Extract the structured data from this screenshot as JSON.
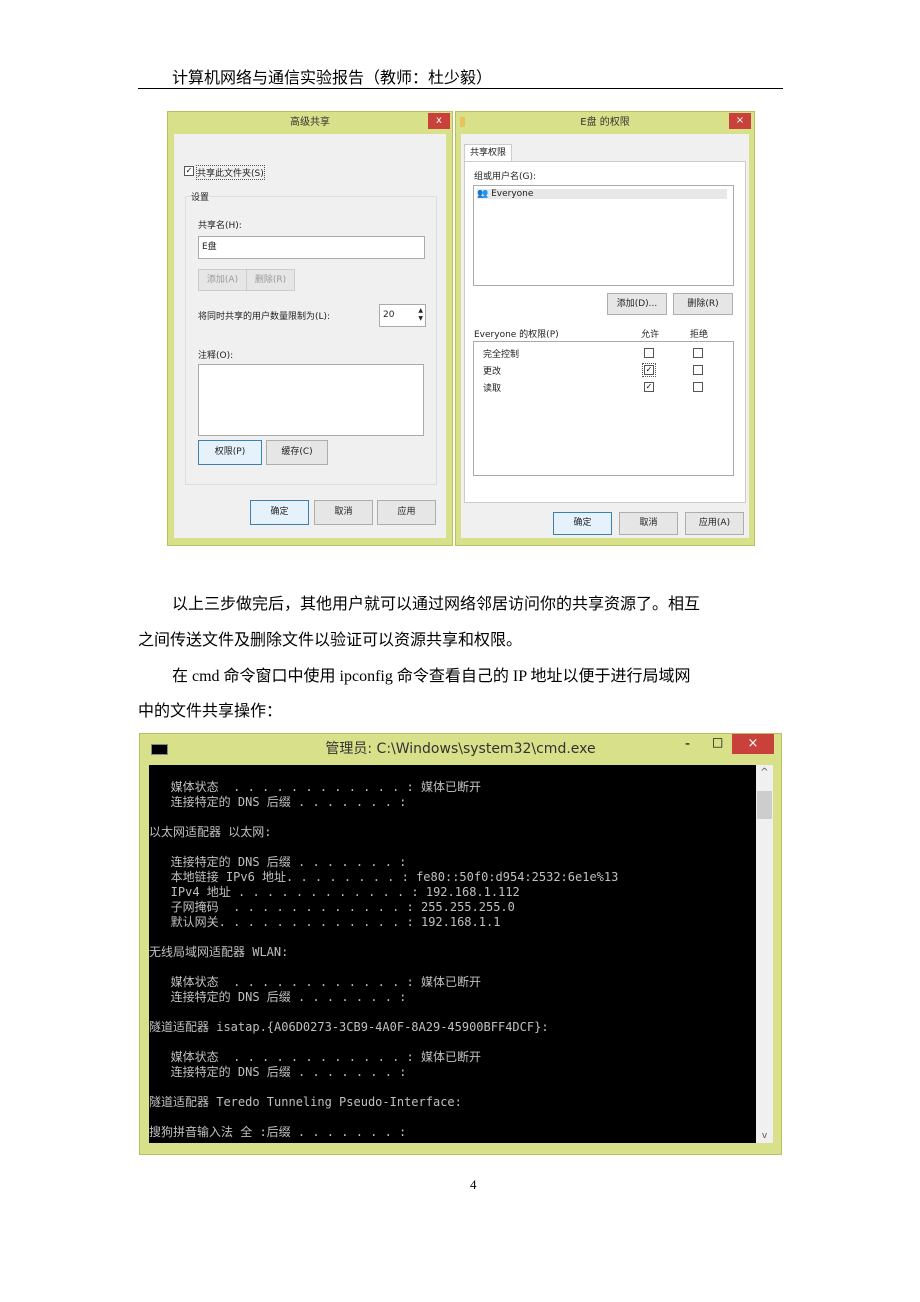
{
  "header": "计算机网络与通信实验报告（教师：杜少毅）",
  "adv_share": {
    "title": "高级共享",
    "close": "x",
    "share_checkbox": "共享此文件夹(S)",
    "settings_group": "设置",
    "share_name_label": "共享名(H):",
    "share_name_value": "E盘",
    "add": "添加(A)",
    "remove": "删除(R)",
    "limit_label": "将同时共享的用户数量限制为(L):",
    "limit_value": "20",
    "comment_label": "注释(O):",
    "permissions": "权限(P)",
    "caching": "缓存(C)",
    "ok": "确定",
    "cancel": "取消",
    "apply": "应用"
  },
  "perm": {
    "title": "E盘 的权限",
    "close": "×",
    "tab": "共享权限",
    "group_label": "组或用户名(G):",
    "users": [
      "Everyone"
    ],
    "add": "添加(D)...",
    "remove": "删除(R)",
    "perm_label": "Everyone 的权限(P)",
    "allow": "允许",
    "deny": "拒绝",
    "rows": [
      {
        "name": "完全控制",
        "allow": false,
        "deny": false
      },
      {
        "name": "更改",
        "allow": true,
        "deny": false
      },
      {
        "name": "读取",
        "allow": true,
        "deny": false
      }
    ],
    "ok": "确定",
    "cancel": "取消",
    "apply": "应用(A)"
  },
  "paragraphs": [
    "以上三步做完后，其他用户就可以通过网络邻居访问你的共享资源了。相互",
    "之间传送文件及删除文件以验证可以资源共享和权限。",
    "在 cmd 命令窗口中使用 ipconfig 命令查看自己的 IP 地址以便于进行局域网",
    "中的文件共享操作："
  ],
  "cmd": {
    "title": "管理员: C:\\Windows\\system32\\cmd.exe",
    "lines": [
      "   媒体状态  . . . . . . . . . . . . : 媒体已断开",
      "   连接特定的 DNS 后缀 . . . . . . . :",
      "",
      "以太网适配器 以太网:",
      "",
      "   连接特定的 DNS 后缀 . . . . . . . :",
      "   本地链接 IPv6 地址. . . . . . . . : fe80::50f0:d954:2532:6e1e%13",
      "   IPv4 地址 . . . . . . . . . . . . : 192.168.1.112",
      "   子网掩码  . . . . . . . . . . . . : 255.255.255.0",
      "   默认网关. . . . . . . . . . . . . : 192.168.1.1",
      "",
      "无线局域网适配器 WLAN:",
      "",
      "   媒体状态  . . . . . . . . . . . . : 媒体已断开",
      "   连接特定的 DNS 后缀 . . . . . . . :",
      "",
      "隧道适配器 isatap.{A06D0273-3CB9-4A0F-8A29-45900BFF4DCF}:",
      "",
      "   媒体状态  . . . . . . . . . . . . : 媒体已断开",
      "   连接特定的 DNS 后缀 . . . . . . . :",
      "",
      "隧道适配器 Teredo Tunneling Pseudo-Interface:",
      "",
      "搜狗拼音输入法 全 :后缀 . . . . . . . :"
    ],
    "minimize": "-",
    "maximize": "□",
    "close": "×",
    "scroll_up": "^",
    "scroll_down": "v"
  },
  "page_number": "4"
}
